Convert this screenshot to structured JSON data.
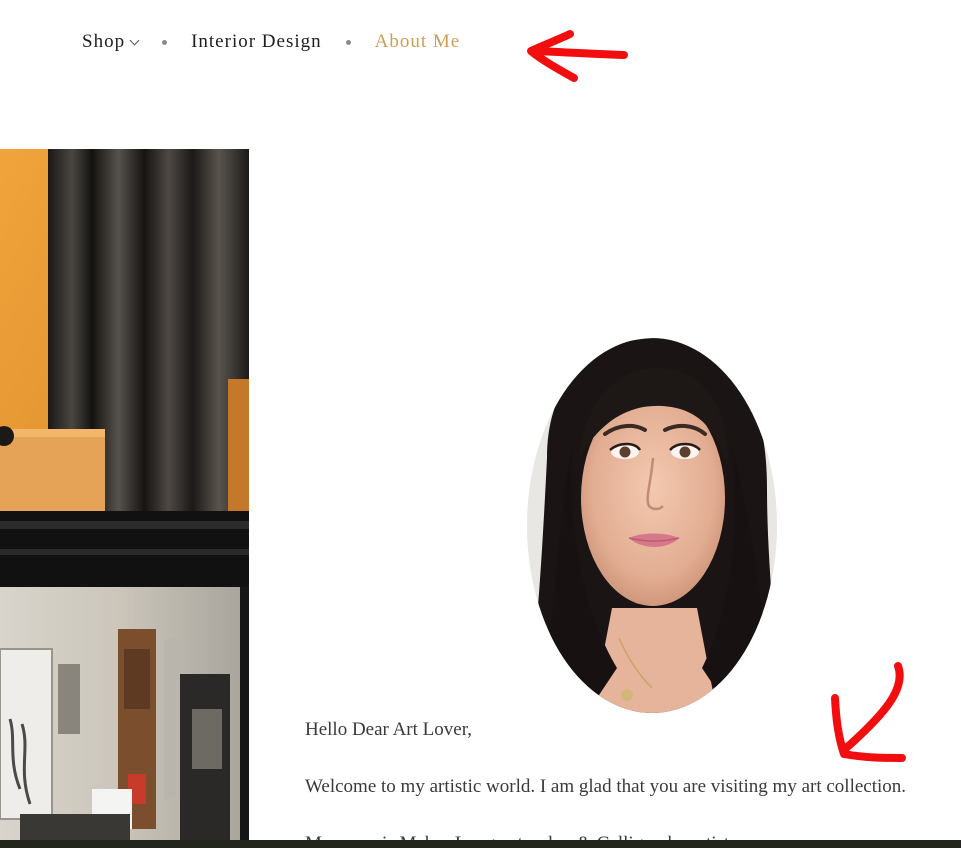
{
  "nav": {
    "items": [
      {
        "label": "Shop",
        "has_dropdown": true,
        "active": false
      },
      {
        "label": "Interior Design",
        "has_dropdown": false,
        "active": false
      },
      {
        "label": "About Me",
        "has_dropdown": false,
        "active": true
      }
    ],
    "active_color": "#cf9d52"
  },
  "content": {
    "greeting": "Hello Dear Art Lover,",
    "welcome": "Welcome to my artistic world. I am glad that you are visiting my art collection.",
    "intro_partial": "My name is Mahsa Lung, a teacher & Calligraphy artist"
  },
  "colors": {
    "annotation": "#f20e0e",
    "text": "#3a3a3a",
    "nav_text": "#1e1e1e"
  }
}
